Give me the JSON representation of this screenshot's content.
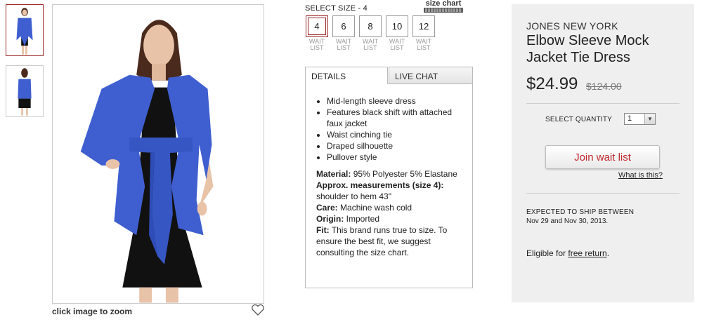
{
  "gallery": {
    "thumbnails": [
      {
        "name": "front view",
        "selected": true
      },
      {
        "name": "back view",
        "selected": false
      }
    ],
    "zoom_hint": "click image to zoom",
    "colors": {
      "dress": "#3f5fd0",
      "shift": "#111111",
      "hair": "#4a2a1c",
      "skin": "#e8c3a8"
    }
  },
  "sizes": {
    "label": "SELECT SIZE - 4",
    "size_chart_label": "size chart",
    "options": [
      {
        "value": "4",
        "status": "WAIT LIST",
        "selected": true
      },
      {
        "value": "6",
        "status": "WAIT LIST",
        "selected": false
      },
      {
        "value": "8",
        "status": "WAIT LIST",
        "selected": false
      },
      {
        "value": "10",
        "status": "WAIT LIST",
        "selected": false
      },
      {
        "value": "12",
        "status": "WAIT LIST",
        "selected": false
      }
    ]
  },
  "tabs": {
    "details_label": "DETAILS",
    "chat_label": "LIVE CHAT",
    "bullets": [
      "Mid-length sleeve dress",
      "Features black shift with attached faux jacket",
      "Waist cinching tie",
      "Draped silhouette",
      "Pullover style"
    ],
    "specs": [
      {
        "key": "Material:",
        "value": "95% Polyester 5% Elastane"
      },
      {
        "key": "Approx. measurements (size 4):",
        "value": "shoulder to hem 43\""
      },
      {
        "key": "Care:",
        "value": "Machine wash cold"
      },
      {
        "key": "Origin:",
        "value": "Imported"
      },
      {
        "key": "Fit:",
        "value": "This brand runs true to size. To ensure the best fit, we suggest consulting the size chart."
      }
    ]
  },
  "product": {
    "brand": "JONES NEW YORK",
    "name": "Elbow Sleeve Mock Jacket Tie Dress",
    "price": "$24.99",
    "original_price": "$124.00",
    "quantity_label": "SELECT QUANTITY",
    "quantity": "1",
    "join_label": "Join wait list",
    "what_label": "What is this?",
    "ship_heading": "EXPECTED TO SHIP BETWEEN",
    "ship_dates": "Nov 29 and Nov 30, 2013.",
    "eligible_prefix": "Eligible for ",
    "eligible_link": "free return",
    "eligible_suffix": ".",
    "accent_color": "#c0282d"
  }
}
